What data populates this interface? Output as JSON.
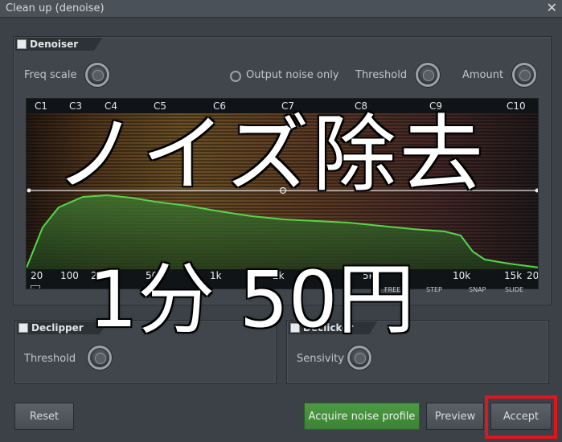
{
  "window": {
    "title": "Clean up (denoise)",
    "close_glyph": "✕"
  },
  "denoiser": {
    "tab_label": "Denoiser",
    "freq_scale_label": "Freq scale",
    "output_noise_only_label": "Output noise only",
    "threshold_label": "Threshold",
    "amount_label": "Amount"
  },
  "spectrum": {
    "octaves": [
      "C1",
      "C3",
      "C4",
      "C5",
      "C6",
      "C7",
      "C8",
      "C9",
      "C10"
    ],
    "freqs": [
      "20",
      "100",
      "200",
      "500",
      "1k",
      "2k",
      "5k",
      "10k",
      "15k",
      "20"
    ],
    "toggles": [
      "FREEZE",
      "STEP",
      "SNAP",
      "SLIDE"
    ],
    "curve_color": "#55d64a"
  },
  "declipper": {
    "tab_label": "Declipper",
    "threshold_label": "Threshold"
  },
  "declicker": {
    "tab_label": "Declicker",
    "sensivity_label": "Sensivity"
  },
  "buttons": {
    "reset": "Reset",
    "acquire": "Acquire noise profile",
    "preview": "Preview",
    "accept": "Accept"
  },
  "overlay": {
    "headline": "ノイズ除去",
    "price": "1分 50円"
  },
  "colors": {
    "accent_green": "#3c8235",
    "highlight_red": "#e3141c"
  }
}
